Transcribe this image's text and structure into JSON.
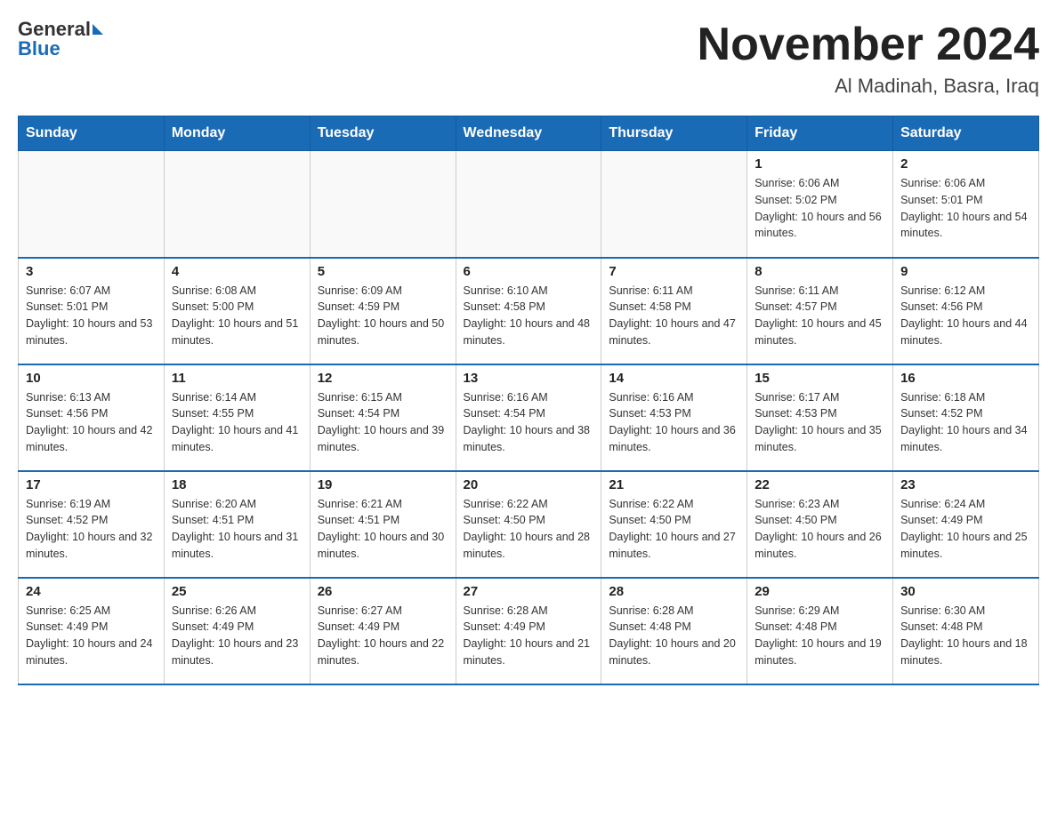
{
  "header": {
    "logo_text_general": "General",
    "logo_text_blue": "Blue",
    "month_title": "November 2024",
    "location": "Al Madinah, Basra, Iraq"
  },
  "weekdays": [
    "Sunday",
    "Monday",
    "Tuesday",
    "Wednesday",
    "Thursday",
    "Friday",
    "Saturday"
  ],
  "weeks": [
    [
      {
        "day": "",
        "sunrise": "",
        "sunset": "",
        "daylight": ""
      },
      {
        "day": "",
        "sunrise": "",
        "sunset": "",
        "daylight": ""
      },
      {
        "day": "",
        "sunrise": "",
        "sunset": "",
        "daylight": ""
      },
      {
        "day": "",
        "sunrise": "",
        "sunset": "",
        "daylight": ""
      },
      {
        "day": "",
        "sunrise": "",
        "sunset": "",
        "daylight": ""
      },
      {
        "day": "1",
        "sunrise": "Sunrise: 6:06 AM",
        "sunset": "Sunset: 5:02 PM",
        "daylight": "Daylight: 10 hours and 56 minutes."
      },
      {
        "day": "2",
        "sunrise": "Sunrise: 6:06 AM",
        "sunset": "Sunset: 5:01 PM",
        "daylight": "Daylight: 10 hours and 54 minutes."
      }
    ],
    [
      {
        "day": "3",
        "sunrise": "Sunrise: 6:07 AM",
        "sunset": "Sunset: 5:01 PM",
        "daylight": "Daylight: 10 hours and 53 minutes."
      },
      {
        "day": "4",
        "sunrise": "Sunrise: 6:08 AM",
        "sunset": "Sunset: 5:00 PM",
        "daylight": "Daylight: 10 hours and 51 minutes."
      },
      {
        "day": "5",
        "sunrise": "Sunrise: 6:09 AM",
        "sunset": "Sunset: 4:59 PM",
        "daylight": "Daylight: 10 hours and 50 minutes."
      },
      {
        "day": "6",
        "sunrise": "Sunrise: 6:10 AM",
        "sunset": "Sunset: 4:58 PM",
        "daylight": "Daylight: 10 hours and 48 minutes."
      },
      {
        "day": "7",
        "sunrise": "Sunrise: 6:11 AM",
        "sunset": "Sunset: 4:58 PM",
        "daylight": "Daylight: 10 hours and 47 minutes."
      },
      {
        "day": "8",
        "sunrise": "Sunrise: 6:11 AM",
        "sunset": "Sunset: 4:57 PM",
        "daylight": "Daylight: 10 hours and 45 minutes."
      },
      {
        "day": "9",
        "sunrise": "Sunrise: 6:12 AM",
        "sunset": "Sunset: 4:56 PM",
        "daylight": "Daylight: 10 hours and 44 minutes."
      }
    ],
    [
      {
        "day": "10",
        "sunrise": "Sunrise: 6:13 AM",
        "sunset": "Sunset: 4:56 PM",
        "daylight": "Daylight: 10 hours and 42 minutes."
      },
      {
        "day": "11",
        "sunrise": "Sunrise: 6:14 AM",
        "sunset": "Sunset: 4:55 PM",
        "daylight": "Daylight: 10 hours and 41 minutes."
      },
      {
        "day": "12",
        "sunrise": "Sunrise: 6:15 AM",
        "sunset": "Sunset: 4:54 PM",
        "daylight": "Daylight: 10 hours and 39 minutes."
      },
      {
        "day": "13",
        "sunrise": "Sunrise: 6:16 AM",
        "sunset": "Sunset: 4:54 PM",
        "daylight": "Daylight: 10 hours and 38 minutes."
      },
      {
        "day": "14",
        "sunrise": "Sunrise: 6:16 AM",
        "sunset": "Sunset: 4:53 PM",
        "daylight": "Daylight: 10 hours and 36 minutes."
      },
      {
        "day": "15",
        "sunrise": "Sunrise: 6:17 AM",
        "sunset": "Sunset: 4:53 PM",
        "daylight": "Daylight: 10 hours and 35 minutes."
      },
      {
        "day": "16",
        "sunrise": "Sunrise: 6:18 AM",
        "sunset": "Sunset: 4:52 PM",
        "daylight": "Daylight: 10 hours and 34 minutes."
      }
    ],
    [
      {
        "day": "17",
        "sunrise": "Sunrise: 6:19 AM",
        "sunset": "Sunset: 4:52 PM",
        "daylight": "Daylight: 10 hours and 32 minutes."
      },
      {
        "day": "18",
        "sunrise": "Sunrise: 6:20 AM",
        "sunset": "Sunset: 4:51 PM",
        "daylight": "Daylight: 10 hours and 31 minutes."
      },
      {
        "day": "19",
        "sunrise": "Sunrise: 6:21 AM",
        "sunset": "Sunset: 4:51 PM",
        "daylight": "Daylight: 10 hours and 30 minutes."
      },
      {
        "day": "20",
        "sunrise": "Sunrise: 6:22 AM",
        "sunset": "Sunset: 4:50 PM",
        "daylight": "Daylight: 10 hours and 28 minutes."
      },
      {
        "day": "21",
        "sunrise": "Sunrise: 6:22 AM",
        "sunset": "Sunset: 4:50 PM",
        "daylight": "Daylight: 10 hours and 27 minutes."
      },
      {
        "day": "22",
        "sunrise": "Sunrise: 6:23 AM",
        "sunset": "Sunset: 4:50 PM",
        "daylight": "Daylight: 10 hours and 26 minutes."
      },
      {
        "day": "23",
        "sunrise": "Sunrise: 6:24 AM",
        "sunset": "Sunset: 4:49 PM",
        "daylight": "Daylight: 10 hours and 25 minutes."
      }
    ],
    [
      {
        "day": "24",
        "sunrise": "Sunrise: 6:25 AM",
        "sunset": "Sunset: 4:49 PM",
        "daylight": "Daylight: 10 hours and 24 minutes."
      },
      {
        "day": "25",
        "sunrise": "Sunrise: 6:26 AM",
        "sunset": "Sunset: 4:49 PM",
        "daylight": "Daylight: 10 hours and 23 minutes."
      },
      {
        "day": "26",
        "sunrise": "Sunrise: 6:27 AM",
        "sunset": "Sunset: 4:49 PM",
        "daylight": "Daylight: 10 hours and 22 minutes."
      },
      {
        "day": "27",
        "sunrise": "Sunrise: 6:28 AM",
        "sunset": "Sunset: 4:49 PM",
        "daylight": "Daylight: 10 hours and 21 minutes."
      },
      {
        "day": "28",
        "sunrise": "Sunrise: 6:28 AM",
        "sunset": "Sunset: 4:48 PM",
        "daylight": "Daylight: 10 hours and 20 minutes."
      },
      {
        "day": "29",
        "sunrise": "Sunrise: 6:29 AM",
        "sunset": "Sunset: 4:48 PM",
        "daylight": "Daylight: 10 hours and 19 minutes."
      },
      {
        "day": "30",
        "sunrise": "Sunrise: 6:30 AM",
        "sunset": "Sunset: 4:48 PM",
        "daylight": "Daylight: 10 hours and 18 minutes."
      }
    ]
  ]
}
